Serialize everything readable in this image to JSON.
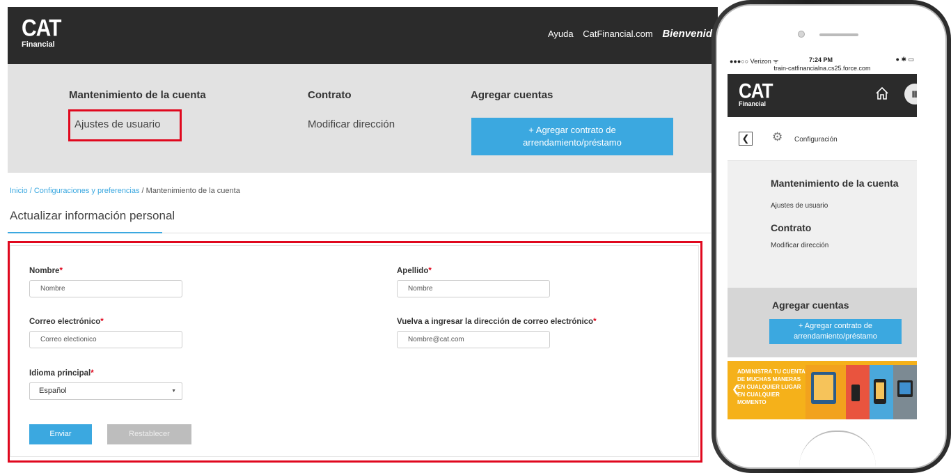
{
  "brand": {
    "logo_main": "CAT",
    "logo_sub": "Financial"
  },
  "desktop": {
    "topnav": {
      "help": "Ayuda",
      "site": "CatFinancial.com",
      "welcome": "Bienvenid"
    },
    "menu": {
      "account_heading": "Mantenimiento de la cuenta",
      "account_link": "Ajustes de usuario",
      "contract_heading": "Contrato",
      "contract_link": "Modificar dirección",
      "add_heading": "Agregar cuentas",
      "add_button_line1": "+ Agregar contrato de",
      "add_button_line2": "arrendamiento/préstamo"
    },
    "breadcrumb": {
      "home": "Inicio",
      "sep1": " / ",
      "settings": "Configuraciones y preferencias",
      "sep2": " / ",
      "current": "Mantenimiento de la cuenta"
    },
    "section_title": "Actualizar información personal",
    "form": {
      "first_name_label": "Nombre",
      "first_name_value": "Nombre",
      "last_name_label": "Apellido",
      "last_name_value": "Nombre",
      "email_label": "Correo electrónico",
      "email_value": "Correo electionico",
      "email_confirm_label": "Vuelva a ingresar la dirección de correo electrónico",
      "email_confirm_value": "Nombre@cat.com",
      "language_label": "Idioma principal",
      "language_value": "Español",
      "required_mark": "*",
      "submit_label": "Enviar",
      "reset_label": "Restablecer"
    }
  },
  "mobile": {
    "status": {
      "carrier": "●●●○○ Verizon ᯤ",
      "time": "7:24 PM",
      "battery": "● ✱ ▭",
      "url": "train-catfinancialna.cs25.force.com"
    },
    "menu_glyph": "III",
    "subbar_title": "Configuración",
    "account_heading": "Mantenimiento de la cuenta",
    "account_link": "Ajustes de usuario",
    "contract_heading": "Contrato",
    "contract_link": "Modificar dirección",
    "add_heading": "Agregar cuentas",
    "add_button_line1": "+ Agregar contrato de",
    "add_button_line2": "arrendamiento/préstamo",
    "banner_lines": [
      "Administra tu cuenta",
      "de muchas maneras",
      "en cualquier lugar",
      "en cualquier momento"
    ]
  },
  "colors": {
    "accent": "#3ba8e0",
    "highlight": "#e0081e",
    "header": "#2b2b2b",
    "banner": "#f5b11a"
  }
}
